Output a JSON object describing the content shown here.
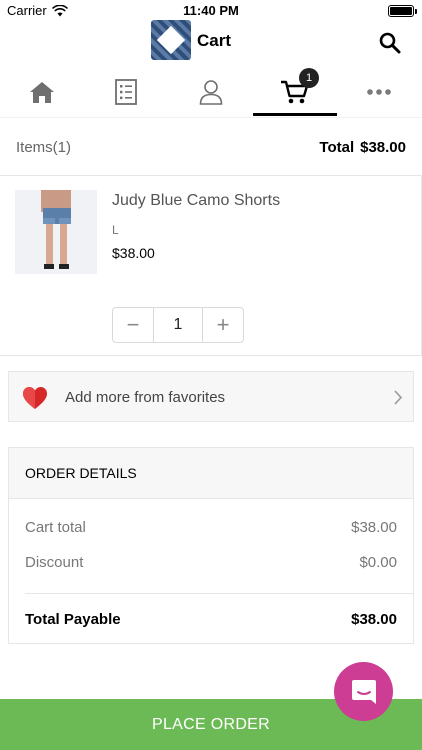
{
  "status_bar": {
    "carrier": "Carrier",
    "time": "11:40 PM"
  },
  "header": {
    "title": "Cart",
    "logo_icon": "store-logo",
    "search_icon": "search-icon"
  },
  "tabs": [
    {
      "name": "home",
      "icon": "home-icon"
    },
    {
      "name": "orders",
      "icon": "list-icon"
    },
    {
      "name": "account",
      "icon": "user-icon"
    },
    {
      "name": "cart",
      "icon": "cart-icon",
      "badge": "1",
      "active": true
    },
    {
      "name": "more",
      "icon": "more-icon"
    }
  ],
  "summary": {
    "items_label": "Items(1)",
    "total_label": "Total",
    "total_value": "$38.00"
  },
  "cart_items": [
    {
      "name": "Judy Blue Camo Shorts",
      "size": "L",
      "price": "$38.00",
      "quantity": "1"
    }
  ],
  "stepper": {
    "minus": "−",
    "plus": "+"
  },
  "favorites": {
    "label": "Add more from favorites",
    "icon": "heart-icon"
  },
  "order_details": {
    "title": "ORDER DETAILS",
    "lines": [
      {
        "label": "Cart total",
        "value": "$38.00"
      },
      {
        "label": "Discount",
        "value": "$0.00"
      }
    ],
    "total_label": "Total Payable",
    "total_value": "$38.00"
  },
  "chat": {
    "icon": "chat-icon"
  },
  "cta": {
    "label": "PLACE ORDER"
  },
  "colors": {
    "accent_green": "#6cba55",
    "chat_pink": "#cc3d93",
    "heart_red": "#d62828"
  }
}
